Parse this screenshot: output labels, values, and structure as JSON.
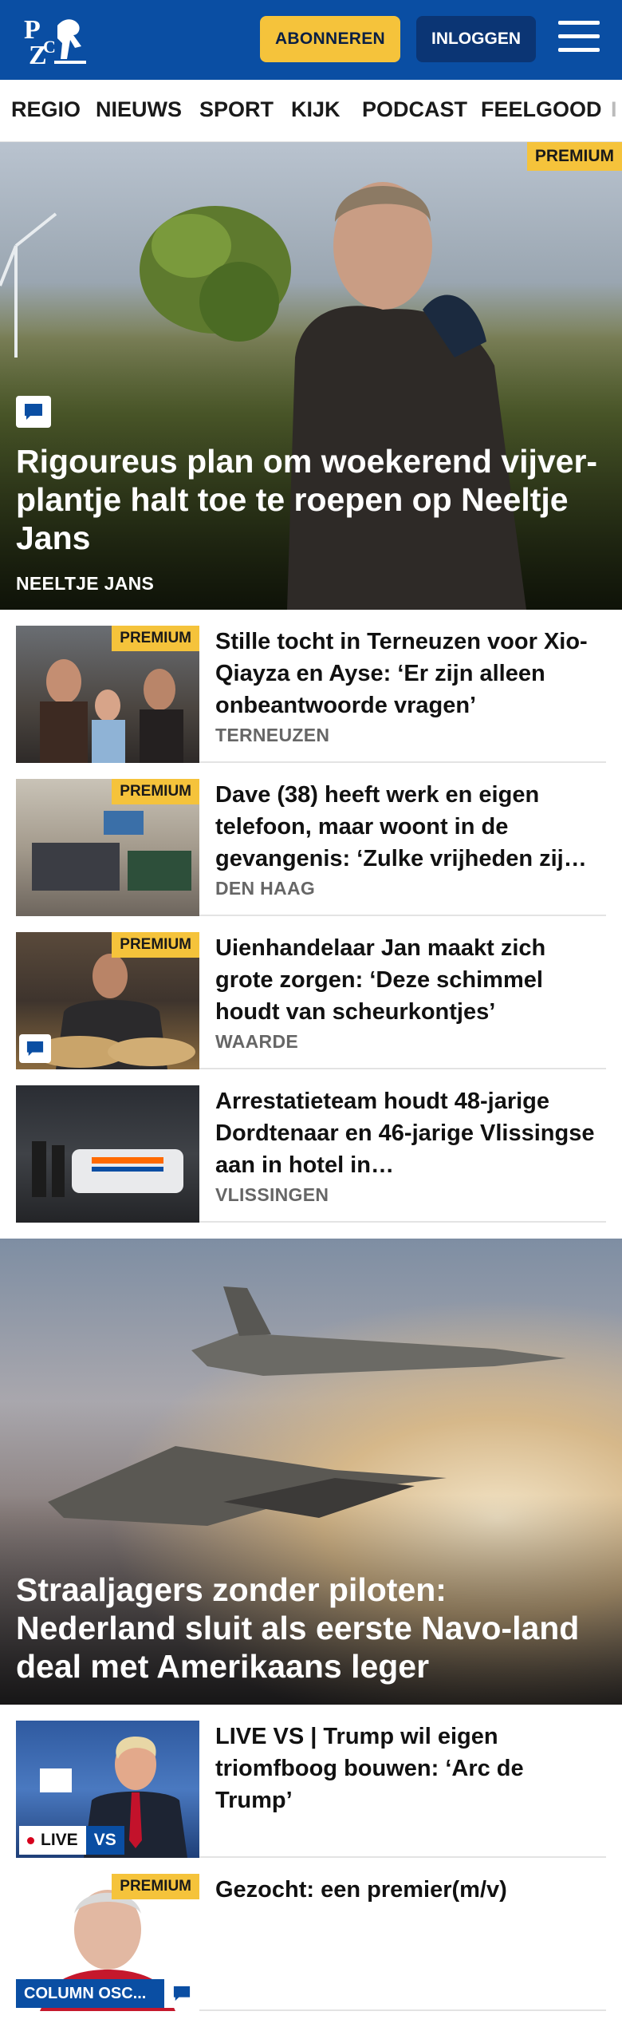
{
  "header": {
    "logo_text": "PZC",
    "subscribe_label": "ABONNEREN",
    "login_label": "INLOGGEN",
    "menu_icon": "hamburger-menu-icon"
  },
  "nav": {
    "items": [
      "REGIO",
      "NIEUWS",
      "SPORT",
      "KIJK",
      "PODCAST",
      "FEELGOOD",
      "I"
    ]
  },
  "hero": {
    "badge": "PREMIUM",
    "title": "Rigoureus plan om woekerend vijver­plantje halt toe te roepen op Neeltje Jans",
    "kicker": "NEELTJE JANS",
    "comment_icon": "comment-icon"
  },
  "articles": [
    {
      "badge": "PREMIUM",
      "title": "Stille tocht in Terneuzen voor Xi­o-Qiayza en Ayse: ‘Er zijn alleen onbeantwoorde vragen’",
      "kicker": "TERNEUZEN"
    },
    {
      "badge": "PREMIUM",
      "title": "Dave (38) heeft werk en eigen telefoon, maar woont in de gevangenis: ‘Zulke vrijheden zij…",
      "kicker": "DEN HAAG"
    },
    {
      "badge": "PREMIUM",
      "title": "Uienhandelaar Jan maakt zich grote zorgen: ‘Deze schimmel houdt van scheurkontjes’",
      "kicker": "WAARDE"
    },
    {
      "badge": "",
      "title": "Arrestatieteam houdt 48-jarige Dordtenaar en 46-jarige Vlissingse aan in hotel in…",
      "kicker": "VLISSINGEN"
    }
  ],
  "feature": {
    "title": "Straaljagers zonder piloten: Nederland sluit als eerste Navo-land deal met Amerikaans leger"
  },
  "more": [
    {
      "title": "LIVE VS | Trump wil eigen triomfboog bouwen: ‘Arc de Trump’",
      "live_label": "LIVE",
      "region_label": "VS"
    },
    {
      "badge": "PREMIUM",
      "title": "Gezocht: een premier(m/v)",
      "column_label": "COLUMN OSC..."
    }
  ]
}
